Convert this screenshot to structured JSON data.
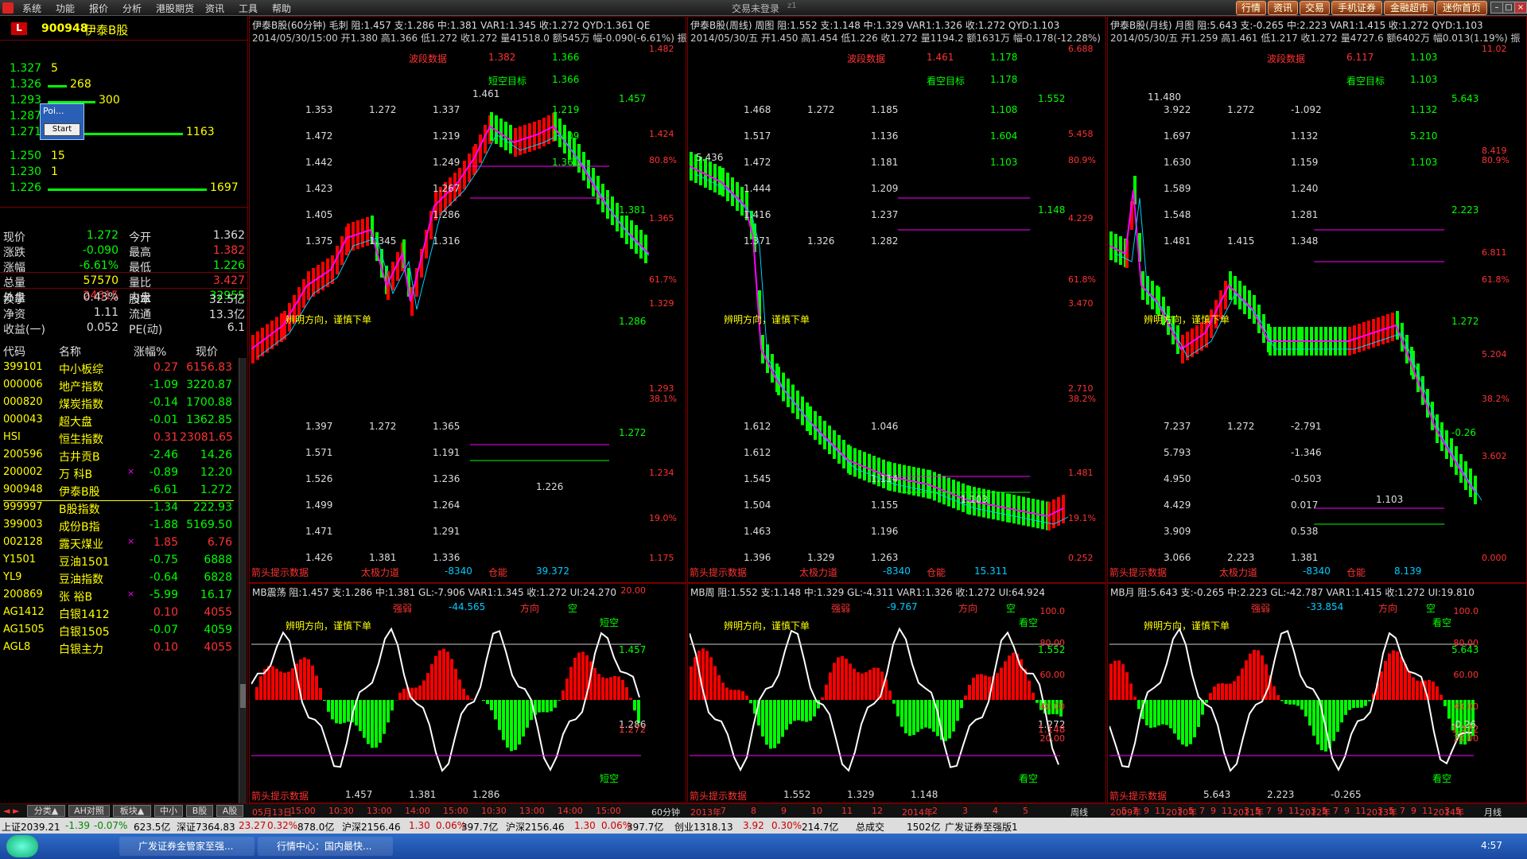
{
  "menu": [
    "系统",
    "功能",
    "报价",
    "分析",
    "港股期货",
    "资讯",
    "工具",
    "帮助"
  ],
  "title": "交易未登录",
  "title_suffix": "z1",
  "top_buttons": [
    "行情",
    "资讯",
    "交易",
    "手机证券",
    "金融超市",
    "迷你首页"
  ],
  "stock": {
    "code": "900948",
    "name": "伊泰B股",
    "icon": "L"
  },
  "order_book": [
    {
      "price": "1.327",
      "vol": "5"
    },
    {
      "price": "1.326",
      "vol": "268"
    },
    {
      "price": "1.293",
      "vol": "300"
    },
    {
      "price": "1.287",
      "vol": ""
    },
    {
      "price": "1.271",
      "vol": "1163"
    },
    {
      "price": "1.250",
      "vol": "15"
    },
    {
      "price": "1.230",
      "vol": "1"
    },
    {
      "price": "1.226",
      "vol": "1697"
    }
  ],
  "popup": {
    "title": "Poi...",
    "button": "Start"
  },
  "quote": [
    {
      "k": "现价",
      "v": "1.272",
      "k2": "今开",
      "v2": "1.362"
    },
    {
      "k": "涨跌",
      "v": "-0.090",
      "k2": "最高",
      "v2": "1.382"
    },
    {
      "k": "涨幅",
      "v": "-6.61%",
      "k2": "最低",
      "v2": "1.226"
    },
    {
      "k": "总量",
      "v": "57570",
      "k2": "量比",
      "v2": "3.427"
    },
    {
      "k": "外盘",
      "v": "24615",
      "k2": "内盘",
      "v2": "32955"
    },
    {
      "k": "换手",
      "v": "0.43%",
      "k2": "股本",
      "v2": "32.5亿"
    },
    {
      "k": "净资",
      "v": "1.11",
      "k2": "流通",
      "v2": "13.3亿"
    },
    {
      "k": "收益(一)",
      "v": "0.052",
      "k2": "PE(动)",
      "v2": "6.1"
    }
  ],
  "list_header": {
    "code": "代码",
    "name": "名称",
    "chg": "涨幅%",
    "price": "现价"
  },
  "list": [
    {
      "code": "399101",
      "name": "中小板综",
      "chg": "0.27",
      "price": "6156.83",
      "up": true
    },
    {
      "code": "000006",
      "name": "地产指数",
      "chg": "-1.09",
      "price": "3220.87",
      "up": false
    },
    {
      "code": "000820",
      "name": "煤炭指数",
      "chg": "-0.14",
      "price": "1700.88",
      "up": false
    },
    {
      "code": "000043",
      "name": "超大盘",
      "chg": "-0.01",
      "price": "1362.85",
      "up": false
    },
    {
      "code": "HSI",
      "name": "恒生指数",
      "chg": "0.31",
      "price": "23081.65",
      "up": true
    },
    {
      "code": "200596",
      "name": "古井贡B",
      "chg": "-2.46",
      "price": "14.26",
      "up": false
    },
    {
      "code": "200002",
      "name": "万 科B",
      "chg": "-0.89",
      "price": "12.20",
      "up": false,
      "mark": "×"
    },
    {
      "code": "900948",
      "name": "伊泰B股",
      "chg": "-6.61",
      "price": "1.272",
      "up": false
    },
    {
      "code": "999997",
      "name": "B股指数",
      "chg": "-1.34",
      "price": "222.93",
      "up": false
    },
    {
      "code": "399003",
      "name": "成份B指",
      "chg": "-1.88",
      "price": "5169.50",
      "up": false
    },
    {
      "code": "002128",
      "name": "露天煤业",
      "chg": "1.85",
      "price": "6.76",
      "up": true,
      "mark": "×"
    },
    {
      "code": "Y1501",
      "name": "豆油1501",
      "chg": "-0.75",
      "price": "6888",
      "up": false
    },
    {
      "code": "YL9",
      "name": "豆油指数",
      "chg": "-0.64",
      "price": "6828",
      "up": false
    },
    {
      "code": "200869",
      "name": "张 裕B",
      "chg": "-5.99",
      "price": "16.17",
      "up": false,
      "mark": "×"
    },
    {
      "code": "AG1412",
      "name": "白银1412",
      "chg": "0.10",
      "price": "4055",
      "up": true
    },
    {
      "code": "AG1505",
      "name": "白银1505",
      "chg": "-0.07",
      "price": "4059",
      "up": false
    },
    {
      "code": "AGL8",
      "name": "白银主力",
      "chg": "0.10",
      "price": "4055",
      "up": true
    }
  ],
  "bottom_tabs": [
    "分类▲",
    "AH对照",
    "板块▲",
    "中小",
    "B股",
    "A股"
  ],
  "panels": [
    {
      "title": "伊泰B股(60分钟) 毛刺 阻:1.457 支:1.286 中:1.381 VAR1:1.345 收:1.272  QYD:1.361 QE",
      "subtitle": "2014/05/30/15:00 开1.380 高1.366 低1.272 收1.272 量41518.0 额545万 幅-0.090(-6.61%) 振",
      "labels": [
        "波段数据",
        "1.382",
        "1.366",
        "短空目标",
        "1.366",
        "1.461"
      ],
      "grid": [
        [
          "1.353",
          "1.272",
          "1.337",
          "1.219"
        ],
        [
          "1.472",
          "",
          "1.219",
          "1.409"
        ],
        [
          "1.442",
          "",
          "1.249",
          "1.361"
        ],
        [
          "1.423",
          "",
          "1.267",
          ""
        ],
        [
          "1.405",
          "",
          "1.286",
          ""
        ],
        [
          "1.375",
          "1.345",
          "1.316",
          ""
        ]
      ],
      "grid2": [
        [
          "1.397",
          "1.272",
          "1.365"
        ],
        [
          "1.571",
          "",
          "1.191"
        ],
        [
          "1.526",
          "",
          "1.236"
        ],
        [
          "1.499",
          "",
          "1.264"
        ],
        [
          "1.471",
          "",
          "1.291"
        ],
        [
          "1.426",
          "1.381",
          "1.336"
        ]
      ],
      "note": "辨明方向，谨慎下单",
      "footer": [
        "箭头提示数据",
        "太极力道",
        "-8340",
        "仓能",
        "39.372"
      ],
      "axis": [
        "1.482",
        "1.424",
        "1.365",
        "1.329",
        "1.293",
        "1.234",
        "1.175"
      ],
      "axis_pct": [
        "80.8%",
        "61.7%",
        "38.1%",
        "19.0%"
      ],
      "right_marks": [
        "1.457",
        "1.381",
        "1.286",
        "1.272"
      ],
      "low": "1.226",
      "ind_title": "MB震荡 阻:1.457 支:1.286 中:1.381 GL:-7.906 VAR1:1.345 收:1.272 UI:24.270",
      "ind_labels": [
        "强弱",
        "-44.565",
        "方向",
        "空"
      ],
      "ind_axis": [
        "20.00"
      ],
      "ind_note": "辨明方向，谨慎下单",
      "ind_right": [
        "短空",
        "1.457",
        "1.286",
        "1.272",
        "短空"
      ],
      "ind_footer": [
        "箭头提示数据",
        "1.457",
        "1.381",
        "1.286"
      ],
      "time_axis": [
        "05月13日",
        "15:00",
        "10:30",
        "13:00",
        "14:00",
        "15:00",
        "10:30",
        "13:00",
        "14:00",
        "15:00"
      ],
      "period": "60分钟"
    },
    {
      "title": "伊泰B股(周线) 周图 阻:1.552 支:1.148 中:1.329 VAR1:1.326 收:1.272  QYD:1.103",
      "subtitle": "2014/05/30/五 开1.450 高1.454 低1.226 收1.272 量1194.2 额1631万 幅-0.178(-12.28%)",
      "labels": [
        "波段数据",
        "1.461",
        "1.178",
        "看空目标",
        "1.178"
      ],
      "grid": [
        [
          "1.468",
          "1.272",
          "1.185",
          "1.108"
        ],
        [
          "1.517",
          "",
          "1.136",
          "1.604"
        ],
        [
          "1.472",
          "",
          "1.181",
          "1.103"
        ],
        [
          "1.444",
          "",
          "1.209",
          ""
        ],
        [
          "1.416",
          "",
          "1.237",
          ""
        ],
        [
          "1.371",
          "1.326",
          "1.282",
          ""
        ]
      ],
      "grid2": [
        [
          "1.612",
          "",
          "1.046"
        ],
        [
          "1.612",
          "",
          ""
        ],
        [
          "1.545",
          "",
          "1.114"
        ],
        [
          "1.504",
          "",
          "1.155"
        ],
        [
          "1.463",
          "",
          "1.196"
        ],
        [
          "1.396",
          "1.329",
          "1.263"
        ]
      ],
      "note": "辨明方向，谨慎下单",
      "footer": [
        "箭头提示数据",
        "太极力道",
        "-8340",
        "仓能",
        "15.311"
      ],
      "axis": [
        "6.688",
        "5.458",
        "4.229",
        "3.470",
        "2.710",
        "1.481",
        "0.252"
      ],
      "axis_pct": [
        "80.9%",
        "61.8%",
        "38.2%",
        "19.1%"
      ],
      "right_marks": [
        "1.552",
        "1.148"
      ],
      "low": "1.103",
      "top_price": "5.436",
      "ind_title": "MB周 阻:1.552 支:1.148 中:1.329 GL:-4.311 VAR1:1.326 收:1.272 UI:64.924",
      "ind_labels": [
        "强弱",
        "-9.767",
        "方向",
        "空"
      ],
      "ind_axis": [
        "100.0",
        "80.00",
        "60.00",
        "40.00",
        "20.00"
      ],
      "ind_note": "辨明方向，谨慎下单",
      "ind_right": [
        "看空",
        "1.552",
        "1.272",
        "1.148",
        "看空"
      ],
      "ind_footer": [
        "箭头提示数据",
        "1.552",
        "1.329",
        "1.148"
      ],
      "time_axis": [
        "2013年",
        "7",
        "8",
        "9",
        "10",
        "11",
        "12",
        "2014年",
        "2",
        "3",
        "4",
        "5"
      ],
      "period": "周线"
    },
    {
      "title": "伊泰B股(月线) 月图 阻:5.643 支:-0.265 中:2.223 VAR1:1.415 收:1.272  QYD:1.103",
      "subtitle": "2014/05/30/五 开1.259 高1.461 低1.217 收1.272 量4727.6 额6402万 幅0.013(1.19%) 振",
      "labels": [
        "波段数据",
        "6.117",
        "1.103",
        "看空目标",
        "1.103"
      ],
      "grid": [
        [
          "3.922",
          "1.272",
          "-1.092",
          "1.132"
        ],
        [
          "1.697",
          "",
          "1.132",
          "5.210"
        ],
        [
          "1.630",
          "",
          "1.159",
          "1.103"
        ],
        [
          "1.589",
          "",
          "1.240",
          ""
        ],
        [
          "1.548",
          "",
          "1.281",
          ""
        ],
        [
          "1.481",
          "1.415",
          "1.348",
          ""
        ]
      ],
      "grid2": [
        [
          "7.237",
          "1.272",
          "-2.791"
        ],
        [
          "5.793",
          "",
          "-1.346"
        ],
        [
          "4.950",
          "",
          "-0.503"
        ],
        [
          "4.429",
          "",
          "0.017"
        ],
        [
          "3.909",
          "",
          "0.538"
        ],
        [
          "3.066",
          "2.223",
          "1.381"
        ]
      ],
      "note": "辨明方向，谨慎下单",
      "footer": [
        "箭头提示数据",
        "太极力道",
        "-8340",
        "仓能",
        "8.139"
      ],
      "axis": [
        "11.02",
        "8.419",
        "6.811",
        "5.204",
        "3.602",
        "0.000"
      ],
      "axis_pct": [
        "80.9%",
        "61.8%",
        "38.2%"
      ],
      "right_marks": [
        "5.643",
        "2.223",
        "1.272",
        "-0.26"
      ],
      "low": "1.103",
      "top_price": "11.480",
      "ind_title": "MB月 阻:5.643 支:-0.265 中:2.223 GL:-42.787 VAR1:1.415 收:1.272 UI:19.810",
      "ind_labels": [
        "强弱",
        "-33.854",
        "方向",
        "空"
      ],
      "ind_axis": [
        "100.0",
        "80.00",
        "60.00",
        "40.00",
        "20.00"
      ],
      "ind_note": "辨明方向，谨慎下单",
      "ind_right": [
        "看空",
        "5.643",
        "-0.26",
        "1.272",
        "看空"
      ],
      "ind_footer": [
        "箭头提示数据",
        "5.643",
        "2.223",
        "-0.265"
      ],
      "time_axis": [
        "2009年",
        "5",
        "7",
        "9",
        "11",
        "2010年",
        "3",
        "5",
        "7",
        "9",
        "11",
        "2011年",
        "3",
        "5",
        "7",
        "9",
        "11",
        "2012年",
        "3",
        "5",
        "7",
        "9",
        "11",
        "2013年",
        "3",
        "5",
        "7",
        "9",
        "11",
        "2014年",
        "3",
        "5"
      ],
      "period": "月线"
    }
  ],
  "statusbar": [
    "上证2039.21",
    "-1.39",
    "-0.07%",
    "623.5亿",
    "深证7364.83",
    "23.27",
    "0.32%",
    "878.0亿",
    "沪深2156.46",
    "1.30",
    "0.06%",
    "397.7亿",
    "沪深2156.46",
    "1.30",
    "0.06%",
    "397.7亿",
    "创业1318.13",
    "3.92",
    "0.30%",
    "214.7亿",
    "总成交",
    "1502亿",
    "广发证券至强版1"
  ],
  "taskbar": {
    "tasks": [
      "广发证券金管家至强...",
      "行情中心：国内最快..."
    ],
    "clock": "4:57"
  },
  "colors": {
    "up": "#ff3333",
    "down": "#00ff00",
    "accent": "#ffff00",
    "frame": "#770000"
  }
}
